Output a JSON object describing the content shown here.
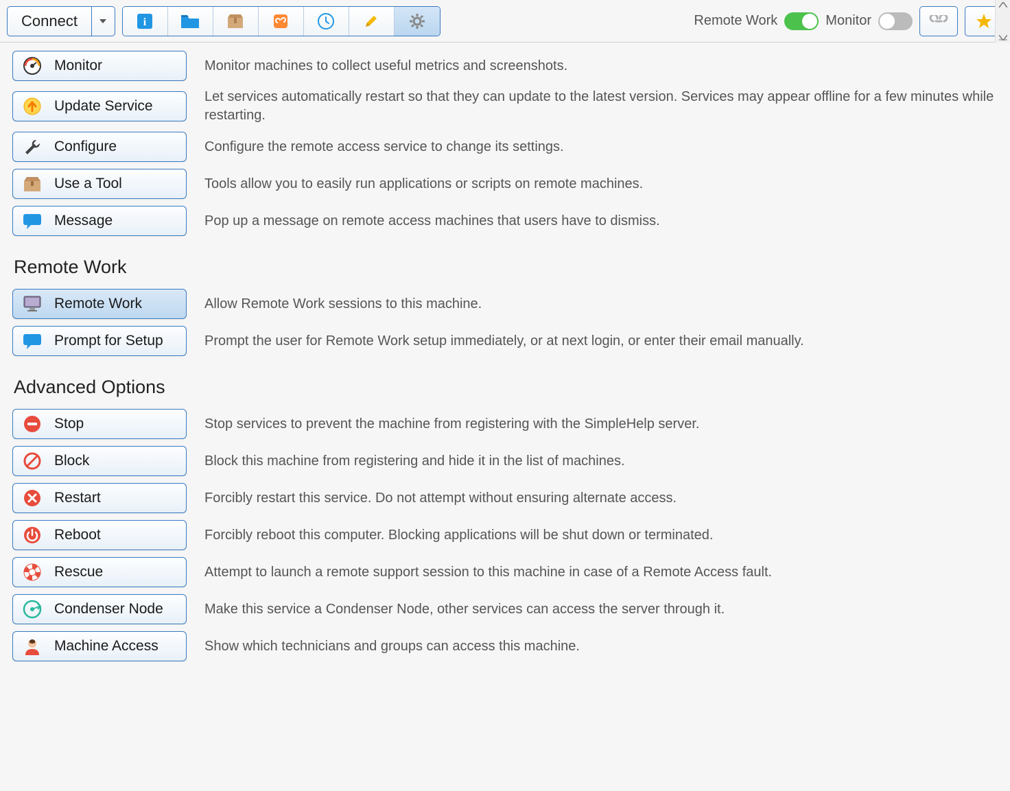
{
  "toolbar": {
    "connect_label": "Connect",
    "remote_work_label": "Remote Work",
    "monitor_label": "Monitor",
    "remote_work_on": true,
    "monitor_on": false
  },
  "sections": {
    "top_items": [
      {
        "label": "Monitor",
        "desc": "Monitor machines to collect useful metrics and screenshots."
      },
      {
        "label": "Update Service",
        "desc": "Let services automatically restart so that they can update to the latest version. Services may appear offline for a few minutes while restarting."
      },
      {
        "label": "Configure",
        "desc": "Configure the remote access service to change its settings."
      },
      {
        "label": "Use a Tool",
        "desc": "Tools allow you to easily run applications or scripts on remote machines."
      },
      {
        "label": "Message",
        "desc": "Pop up a message on remote access machines that users have to dismiss."
      }
    ],
    "remote_work_title": "Remote Work",
    "remote_work_items": [
      {
        "label": "Remote Work",
        "desc": "Allow Remote Work sessions to this machine."
      },
      {
        "label": "Prompt for Setup",
        "desc": "Prompt the user for Remote Work setup immediately, or at next login, or enter their email manually."
      }
    ],
    "advanced_title": "Advanced Options",
    "advanced_items": [
      {
        "label": "Stop",
        "desc": "Stop services to prevent the machine from registering with the SimpleHelp server."
      },
      {
        "label": "Block",
        "desc": "Block this machine from registering and hide it in the list of machines."
      },
      {
        "label": "Restart",
        "desc": "Forcibly restart this service. Do not attempt without ensuring alternate access."
      },
      {
        "label": "Reboot",
        "desc": "Forcibly reboot this computer. Blocking applications will be shut down or terminated."
      },
      {
        "label": "Rescue",
        "desc": "Attempt to launch a remote support session to this machine in case of a Remote Access fault."
      },
      {
        "label": "Condenser Node",
        "desc": "Make this service a Condenser Node, other services can access the server through it."
      },
      {
        "label": "Machine Access",
        "desc": "Show which technicians and groups can access this machine."
      }
    ]
  }
}
